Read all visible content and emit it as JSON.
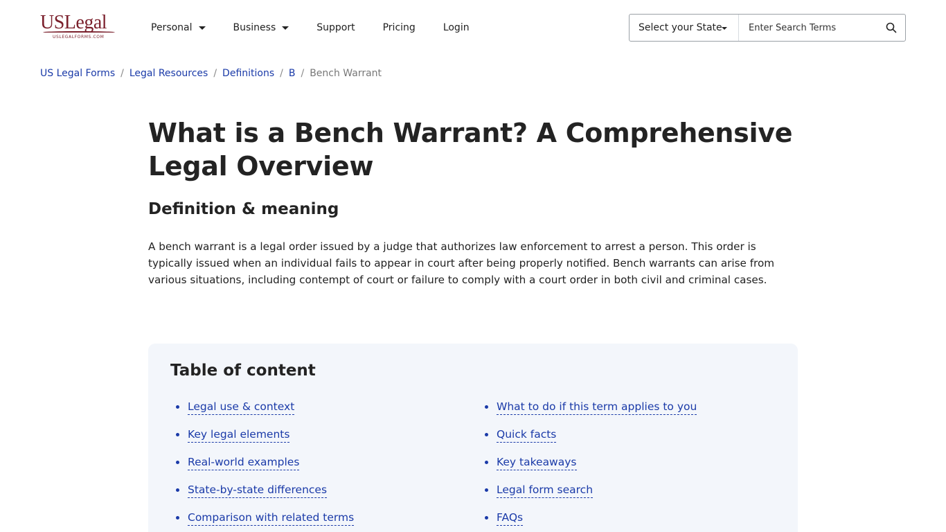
{
  "brand": {
    "logo_main": "USLegal",
    "logo_sub": "USLEGALFORMS.COM"
  },
  "nav": {
    "items": [
      {
        "label": "Personal",
        "dropdown": true
      },
      {
        "label": "Business",
        "dropdown": true
      },
      {
        "label": "Support",
        "dropdown": false
      },
      {
        "label": "Pricing",
        "dropdown": false
      },
      {
        "label": "Login",
        "dropdown": false
      }
    ]
  },
  "search": {
    "state_label": "Select your State",
    "placeholder": "Enter Search Terms",
    "icon": "search-icon"
  },
  "breadcrumb": {
    "items": [
      "US Legal Forms",
      "Legal Resources",
      "Definitions",
      "B"
    ],
    "separator": "/",
    "current": "Bench Warrant"
  },
  "article": {
    "title": "What is a Bench Warrant? A Comprehensive Legal Overview",
    "subtitle": "Definition & meaning",
    "paragraph": "A bench warrant is a legal order issued by a judge that authorizes law enforcement to arrest a person. This order is typically issued when an individual fails to appear in court after being properly notified. Bench warrants can arise from various situations, including contempt of court or failure to comply with a court order in both civil and criminal cases."
  },
  "toc": {
    "title": "Table of content",
    "left": [
      "Legal use & context",
      "Key legal elements",
      "Real-world examples",
      "State-by-state differences",
      "Comparison with related terms"
    ],
    "right": [
      "What to do if this term applies to you",
      "Quick facts",
      "Key takeaways",
      "Legal form search",
      "FAQs"
    ]
  },
  "colors": {
    "brand": "#7a1f2b",
    "link": "#1a3aa8",
    "toc_background": "#f3f6fb"
  }
}
